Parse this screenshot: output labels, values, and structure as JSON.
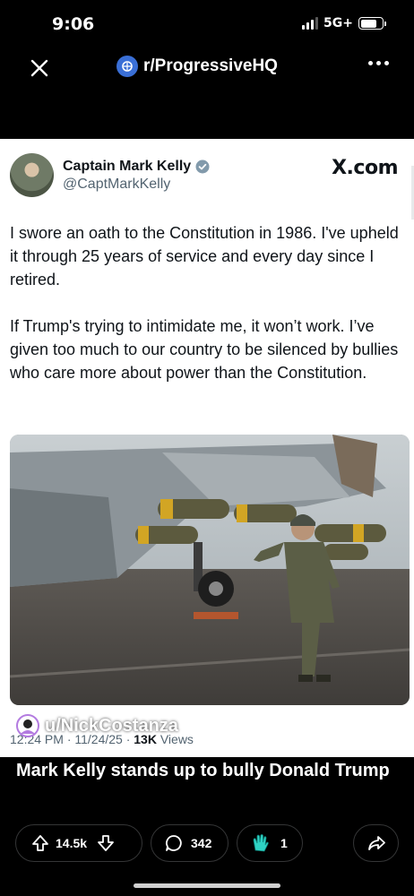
{
  "status_bar": {
    "time": "9:06",
    "network": "5G+",
    "signal_bars": 3,
    "battery_level": 0.75
  },
  "header": {
    "subreddit": "r/ProgressiveHQ",
    "icons": [
      "close-icon",
      "subreddit-icon",
      "more-icon"
    ]
  },
  "tweet": {
    "author_name": "Captain Mark Kelly",
    "author_handle": "@CaptMarkKelly",
    "source_label": "X.com",
    "paragraphs": [
      "I swore an oath to the Constitution in 1986. I've upheld it through 25 years of service and every day since I retired.",
      "If Trump's trying to intimidate me, it won’t work. I’ve given too much to our country to be silenced by bullies who care more about power than the Constitution."
    ],
    "meta_time": "12:24 PM · 11/24/25 · ",
    "meta_views_count": "13K",
    "meta_views_label": " Views",
    "verified_color": "#829aab"
  },
  "post": {
    "username": "u/NickCostanza",
    "title": "Mark Kelly stands up to bully Donald Trump"
  },
  "actions": {
    "upvotes": "14.5k",
    "comments": "342",
    "awards": "1",
    "icons": [
      "upvote-icon",
      "downvote-icon",
      "comment-icon",
      "award-icon",
      "share-icon"
    ]
  },
  "colors": {
    "background": "#000000",
    "card": "#ffffff",
    "pill_border": "#343536",
    "award": "#2fd3c4"
  }
}
